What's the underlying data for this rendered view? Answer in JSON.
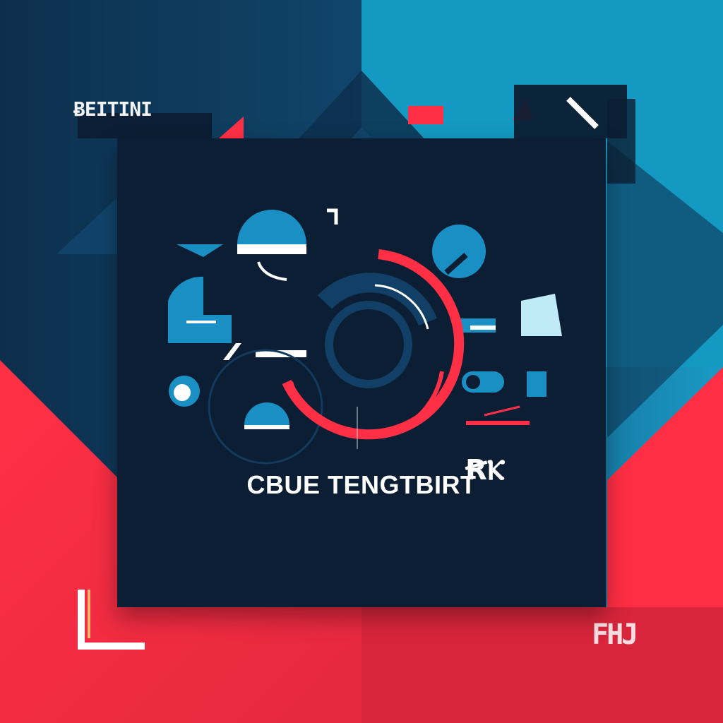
{
  "brand": {
    "name": "CBUE TENGTBIRT",
    "glyph": "ꞦⲔ"
  },
  "corner_marks": {
    "top_left": "ɃEITINI",
    "bottom_right": "FHJ"
  },
  "palette": {
    "navy": "#0c1e33",
    "deep_blue": "#0f3a5a",
    "cyan": "#1596bf",
    "red": "#ff2f45",
    "white": "#ffffff"
  },
  "icons": [
    "ring-logo-icon",
    "chat-bubble-icon",
    "document-icon",
    "toggle-icon",
    "dome-icon",
    "cube-icon"
  ]
}
